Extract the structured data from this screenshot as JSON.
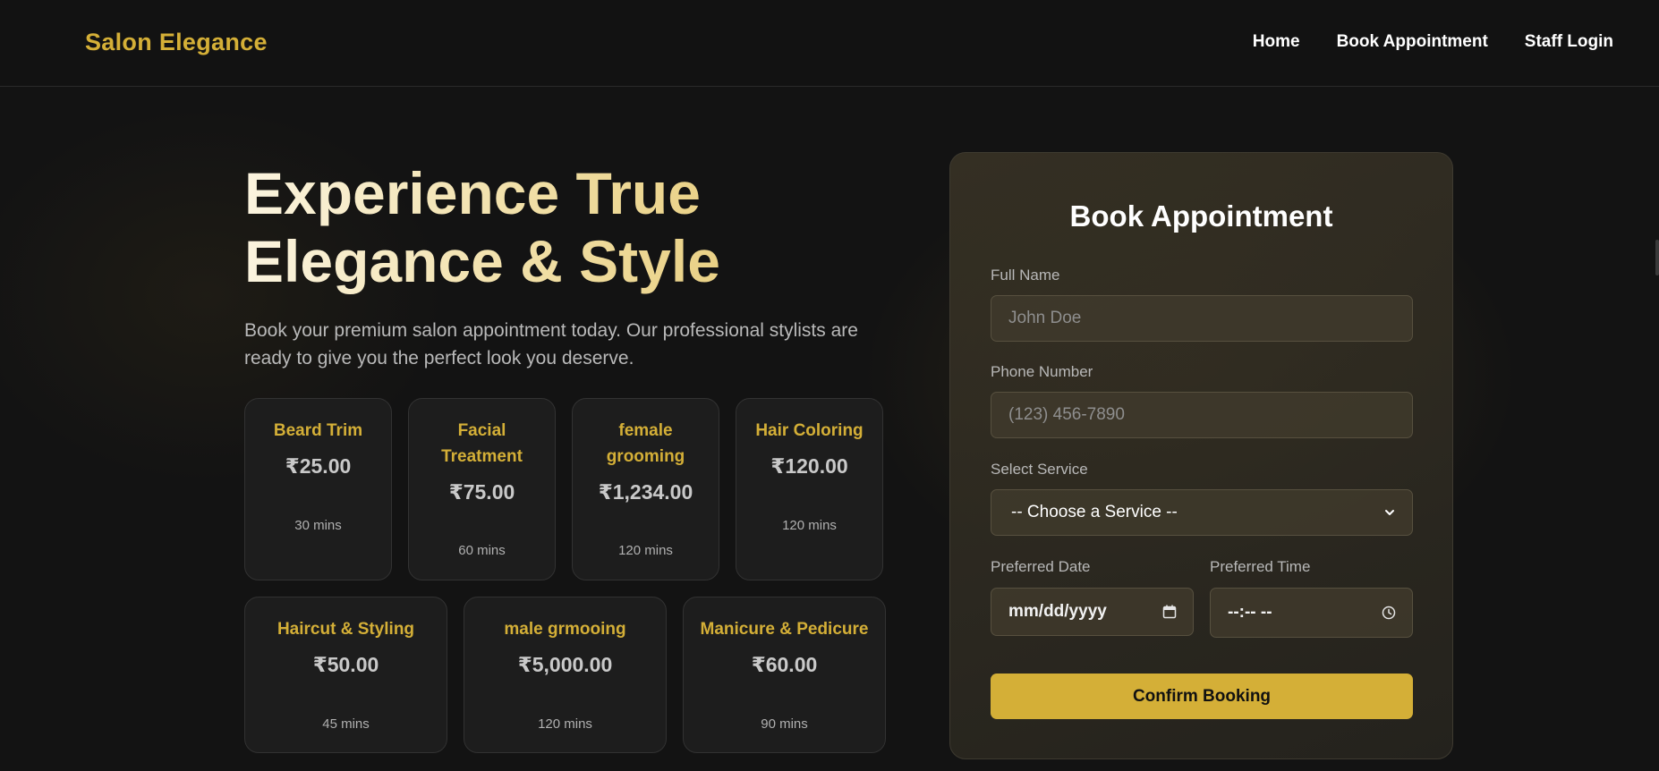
{
  "nav": {
    "brand": "Salon Elegance",
    "links": [
      "Home",
      "Book Appointment",
      "Staff Login"
    ]
  },
  "hero": {
    "title_line1": "Experience True",
    "title_line2": "Elegance & Style",
    "subtitle": "Book your premium salon appointment today. Our professional stylists are ready to give you the perfect look you deserve."
  },
  "services": [
    {
      "name": "Beard Trim",
      "price": "₹25.00",
      "duration": "30 mins"
    },
    {
      "name": "Facial Treatment",
      "price": "₹75.00",
      "duration": "60 mins"
    },
    {
      "name": "female grooming",
      "price": "₹1,234.00",
      "duration": "120 mins"
    },
    {
      "name": "Hair Coloring",
      "price": "₹120.00",
      "duration": "120 mins"
    },
    {
      "name": "Haircut & Styling",
      "price": "₹50.00",
      "duration": "45 mins"
    },
    {
      "name": "male grmooing",
      "price": "₹5,000.00",
      "duration": "120 mins"
    },
    {
      "name": "Manicure & Pedicure",
      "price": "₹60.00",
      "duration": "90 mins"
    }
  ],
  "booking": {
    "title": "Book Appointment",
    "full_name_label": "Full Name",
    "full_name_placeholder": "John Doe",
    "phone_label": "Phone Number",
    "phone_placeholder": "(123) 456-7890",
    "service_label": "Select Service",
    "service_selected": "-- Choose a Service --",
    "date_label": "Preferred Date",
    "date_value": "mm/dd/yyyy",
    "time_label": "Preferred Time",
    "time_value": "--:-- --",
    "confirm_label": "Confirm Booking"
  },
  "colors": {
    "accent": "#d4af37",
    "background": "#121212",
    "card": "#1d1d1d"
  }
}
